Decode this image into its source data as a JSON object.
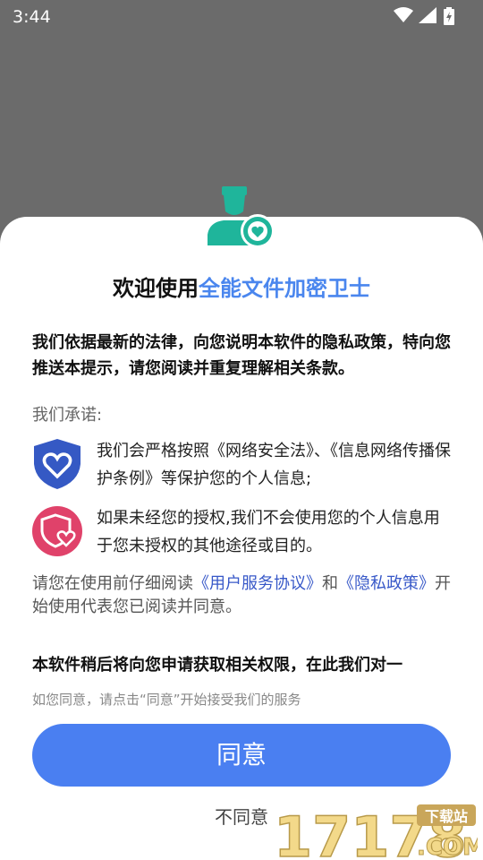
{
  "status": {
    "time": "3:44"
  },
  "dialog": {
    "title_prefix": "欢迎使用",
    "title_app_name": "全能文件加密卫士",
    "intro": "我们依据最新的法律，向您说明本软件的隐私政策，特向您推送本提示，请您阅读并重复理解相关条款。",
    "promise_label": "我们承诺:",
    "pledges": [
      {
        "icon": "shield-heart-icon",
        "text": "我们会严格按照《网络安全法》、《信息网络传播保护条例》等保护您的个人信息;"
      },
      {
        "icon": "heart-shield-icon",
        "text": "如果未经您的授权,我们不会使用您的个人信息用于您未授权的其他途径或目的。"
      }
    ],
    "notice_prefix": "请您在使用前仔细阅读",
    "user_agreement_link": "《用户服务协议》",
    "notice_and": "和",
    "privacy_link": "《隐私政策》",
    "notice_suffix": "开始使用代表您已阅读并同意。",
    "permission_text": "本软件稍后将向您申请获取相关权限，在此我们对一",
    "hint": "如您同意，请点击“同意”开始接受我们的服务",
    "agree_label": "同意",
    "disagree_label": "不同意"
  },
  "watermark": {
    "number": "17178",
    "tag": "下载站",
    "domain": ".COM"
  },
  "colors": {
    "accent": "#4a86ee",
    "button": "#4a7ff1",
    "teal": "#1fb59b",
    "pink": "#e0426a",
    "blue_shield": "#3559c4"
  }
}
